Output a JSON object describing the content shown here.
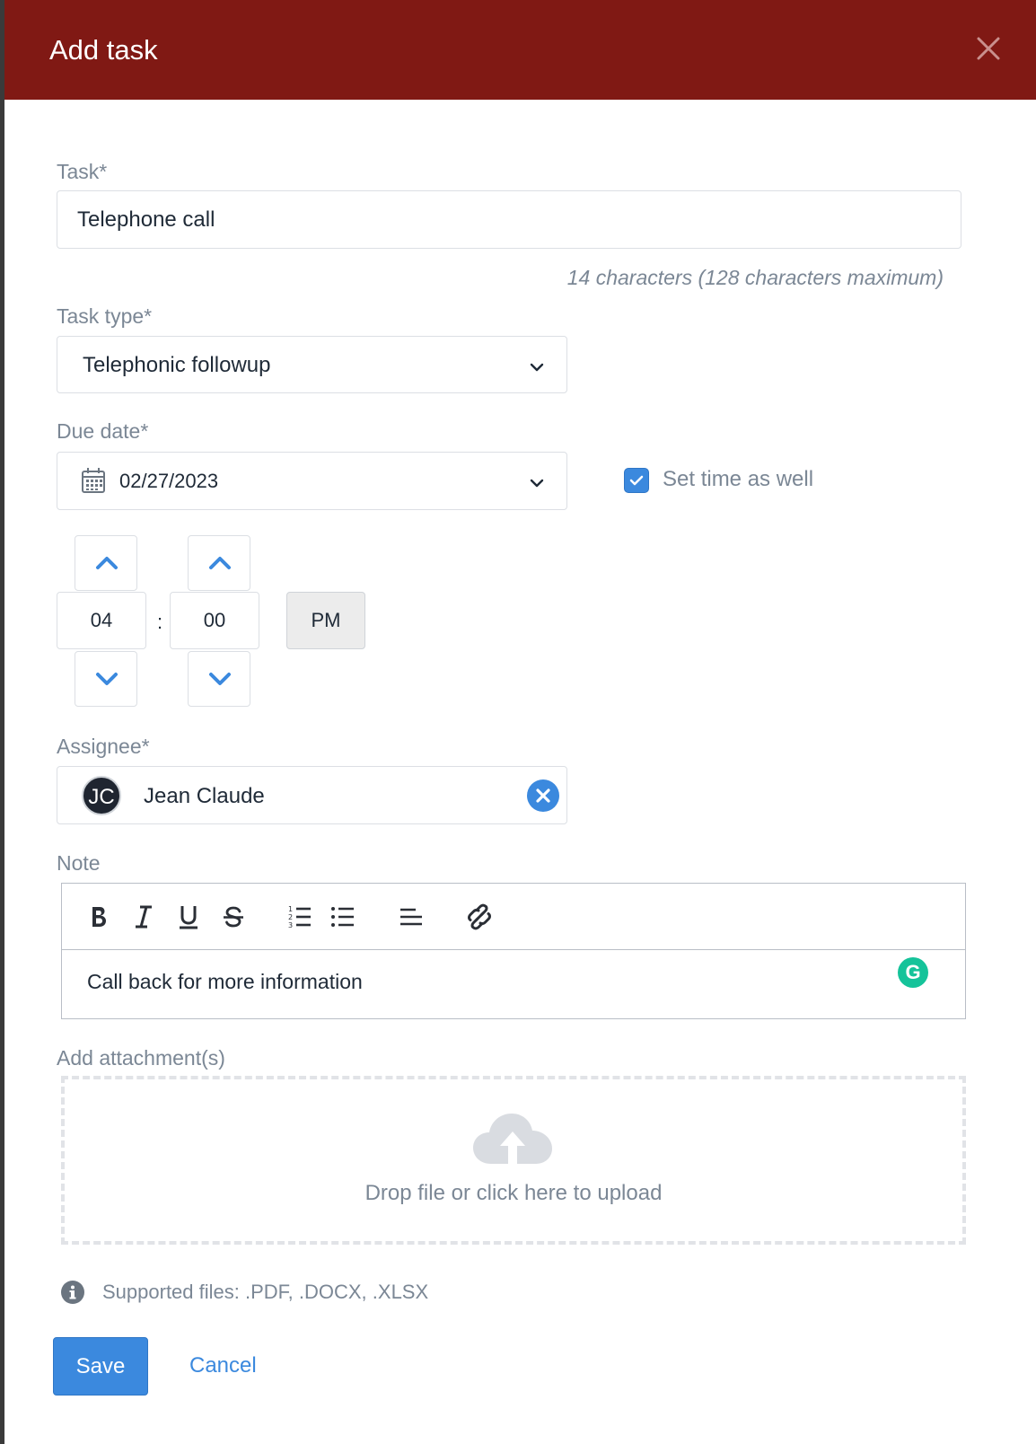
{
  "dialog": {
    "title": "Add task",
    "close_icon": "close-icon",
    "header_color": "#801914"
  },
  "task": {
    "label": "Task*",
    "value": "Telephone call",
    "char_count": "14 characters (128 characters maximum)"
  },
  "task_type": {
    "label": "Task type*",
    "selected": "Telephonic followup",
    "icon": "chevron-down-icon"
  },
  "due_date": {
    "label": "Due date*",
    "value": "02/27/2023",
    "icon": "calendar-icon",
    "set_time_label": "Set time as well",
    "set_time_checked": true
  },
  "time": {
    "hour": "04",
    "separator": ":",
    "minute": "00",
    "period": "PM"
  },
  "assignee": {
    "label": "Assignee*",
    "initials": "JC",
    "name": "Jean Claude"
  },
  "note": {
    "label": "Note",
    "toolbar": [
      "bold-icon",
      "italic-icon",
      "underline-icon",
      "strikethrough-icon",
      "ordered-list-icon",
      "bullet-list-icon",
      "align-left-icon",
      "link-icon"
    ],
    "text": "Call back for more information",
    "grammarly_letter": "G"
  },
  "attachments": {
    "label": "Add attachment(s)",
    "drop_text": "Drop file or click here to upload",
    "supported": "Supported files: .PDF, .DOCX, .XLSX"
  },
  "actions": {
    "save_label": "Save",
    "cancel_label": "Cancel"
  },
  "colors": {
    "primary": "#3b89de",
    "label_gray": "#7b8795",
    "text_dark": "#1f2a37"
  }
}
